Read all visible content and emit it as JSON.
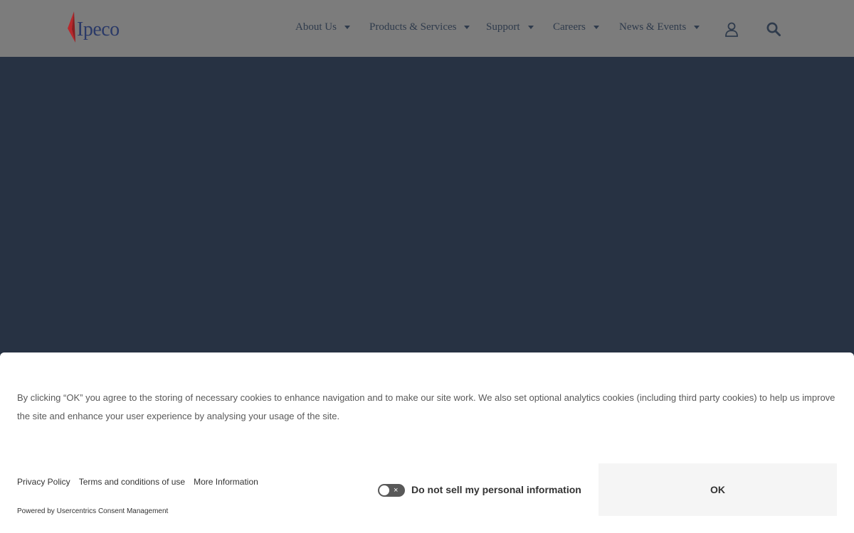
{
  "header": {
    "logo_text": "Ipeco",
    "nav": [
      {
        "label": "About Us"
      },
      {
        "label": "Products & Services"
      },
      {
        "label": "Support"
      },
      {
        "label": "Careers"
      },
      {
        "label": "News & Events"
      }
    ],
    "icons": [
      "user-icon",
      "search-icon"
    ]
  },
  "cookie_banner": {
    "text": "By clicking “OK” you agree to the storing of necessary cookies to enhance navigation and to make our site work. We also set optional analytics cookies (including third party cookies) to help us improve the site and enhance your user experience by analysing your usage of the site.",
    "links": {
      "privacy": "Privacy Policy",
      "terms": "Terms and conditions of use",
      "more": "More Information"
    },
    "powered_by_prefix": "Powered by ",
    "powered_by_link": "Usercentrics Consent Management",
    "do_not_sell_label": "Do not sell my personal information",
    "toggle_symbol": "×",
    "ok_label": "OK"
  },
  "colors": {
    "header_bg": "#7c7c7c",
    "hero_bg": "#273243",
    "logo_red": "#b8282c",
    "logo_navy": "#2b3a68"
  }
}
